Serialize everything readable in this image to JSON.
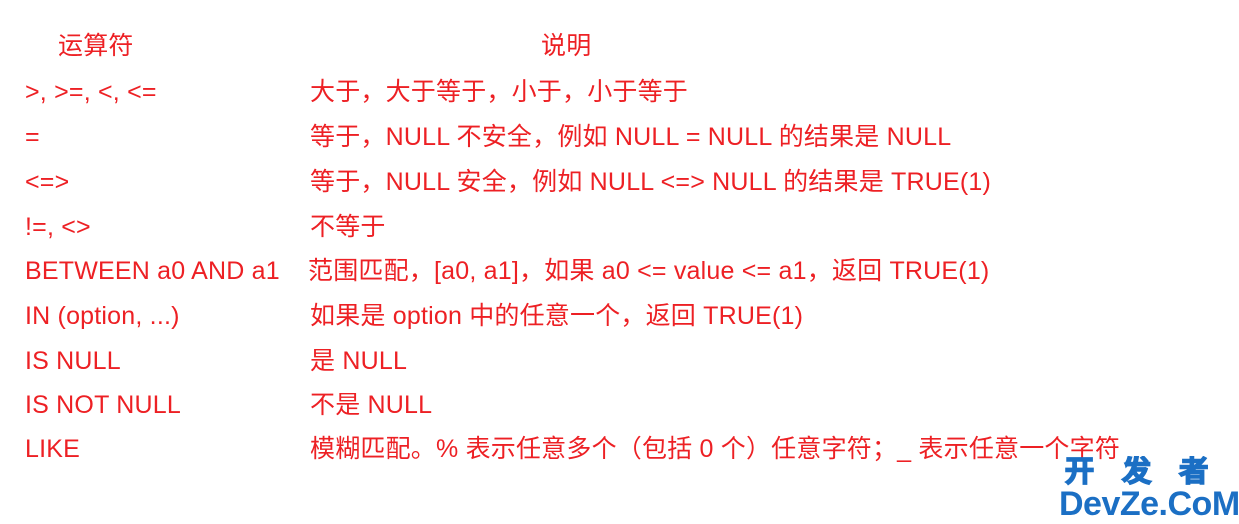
{
  "page": {
    "background_color": "#ffffff",
    "text_color": "#ed2024"
  },
  "table": {
    "headers": {
      "operator": "运算符",
      "description": "说明"
    },
    "rows": [
      {
        "operator": ">, >=, <, <=",
        "description": "大于，大于等于，小于，小于等于",
        "wide": false
      },
      {
        "operator": "=",
        "description": "等于，NULL 不安全，例如 NULL = NULL 的结果是 NULL",
        "wide": false
      },
      {
        "operator": "<=>",
        "description": "等于，NULL 安全，例如 NULL <=> NULL 的结果是 TRUE(1)",
        "wide": false
      },
      {
        "operator": "!=, <>",
        "description": "不等于",
        "wide": false
      },
      {
        "operator": "BETWEEN a0 AND a1",
        "description": "范围匹配，[a0, a1]，如果 a0 <= value <= a1，返回 TRUE(1)",
        "wide": true
      },
      {
        "operator": "IN (option, ...)",
        "description": "如果是 option 中的任意一个，返回 TRUE(1)",
        "wide": false
      },
      {
        "operator": "IS NULL",
        "description": "是 NULL",
        "wide": false
      },
      {
        "operator": "IS NOT NULL",
        "description": "不是 NULL",
        "wide": false
      },
      {
        "operator": "LIKE",
        "description": "模糊匹配。% 表示任意多个（包括 0 个）任意字符；_ 表示任意一个字符",
        "wide": false
      }
    ]
  },
  "watermark": {
    "cn": "开 发 者",
    "en": "DevZe.CoM",
    "color": "#1b6fc4"
  }
}
